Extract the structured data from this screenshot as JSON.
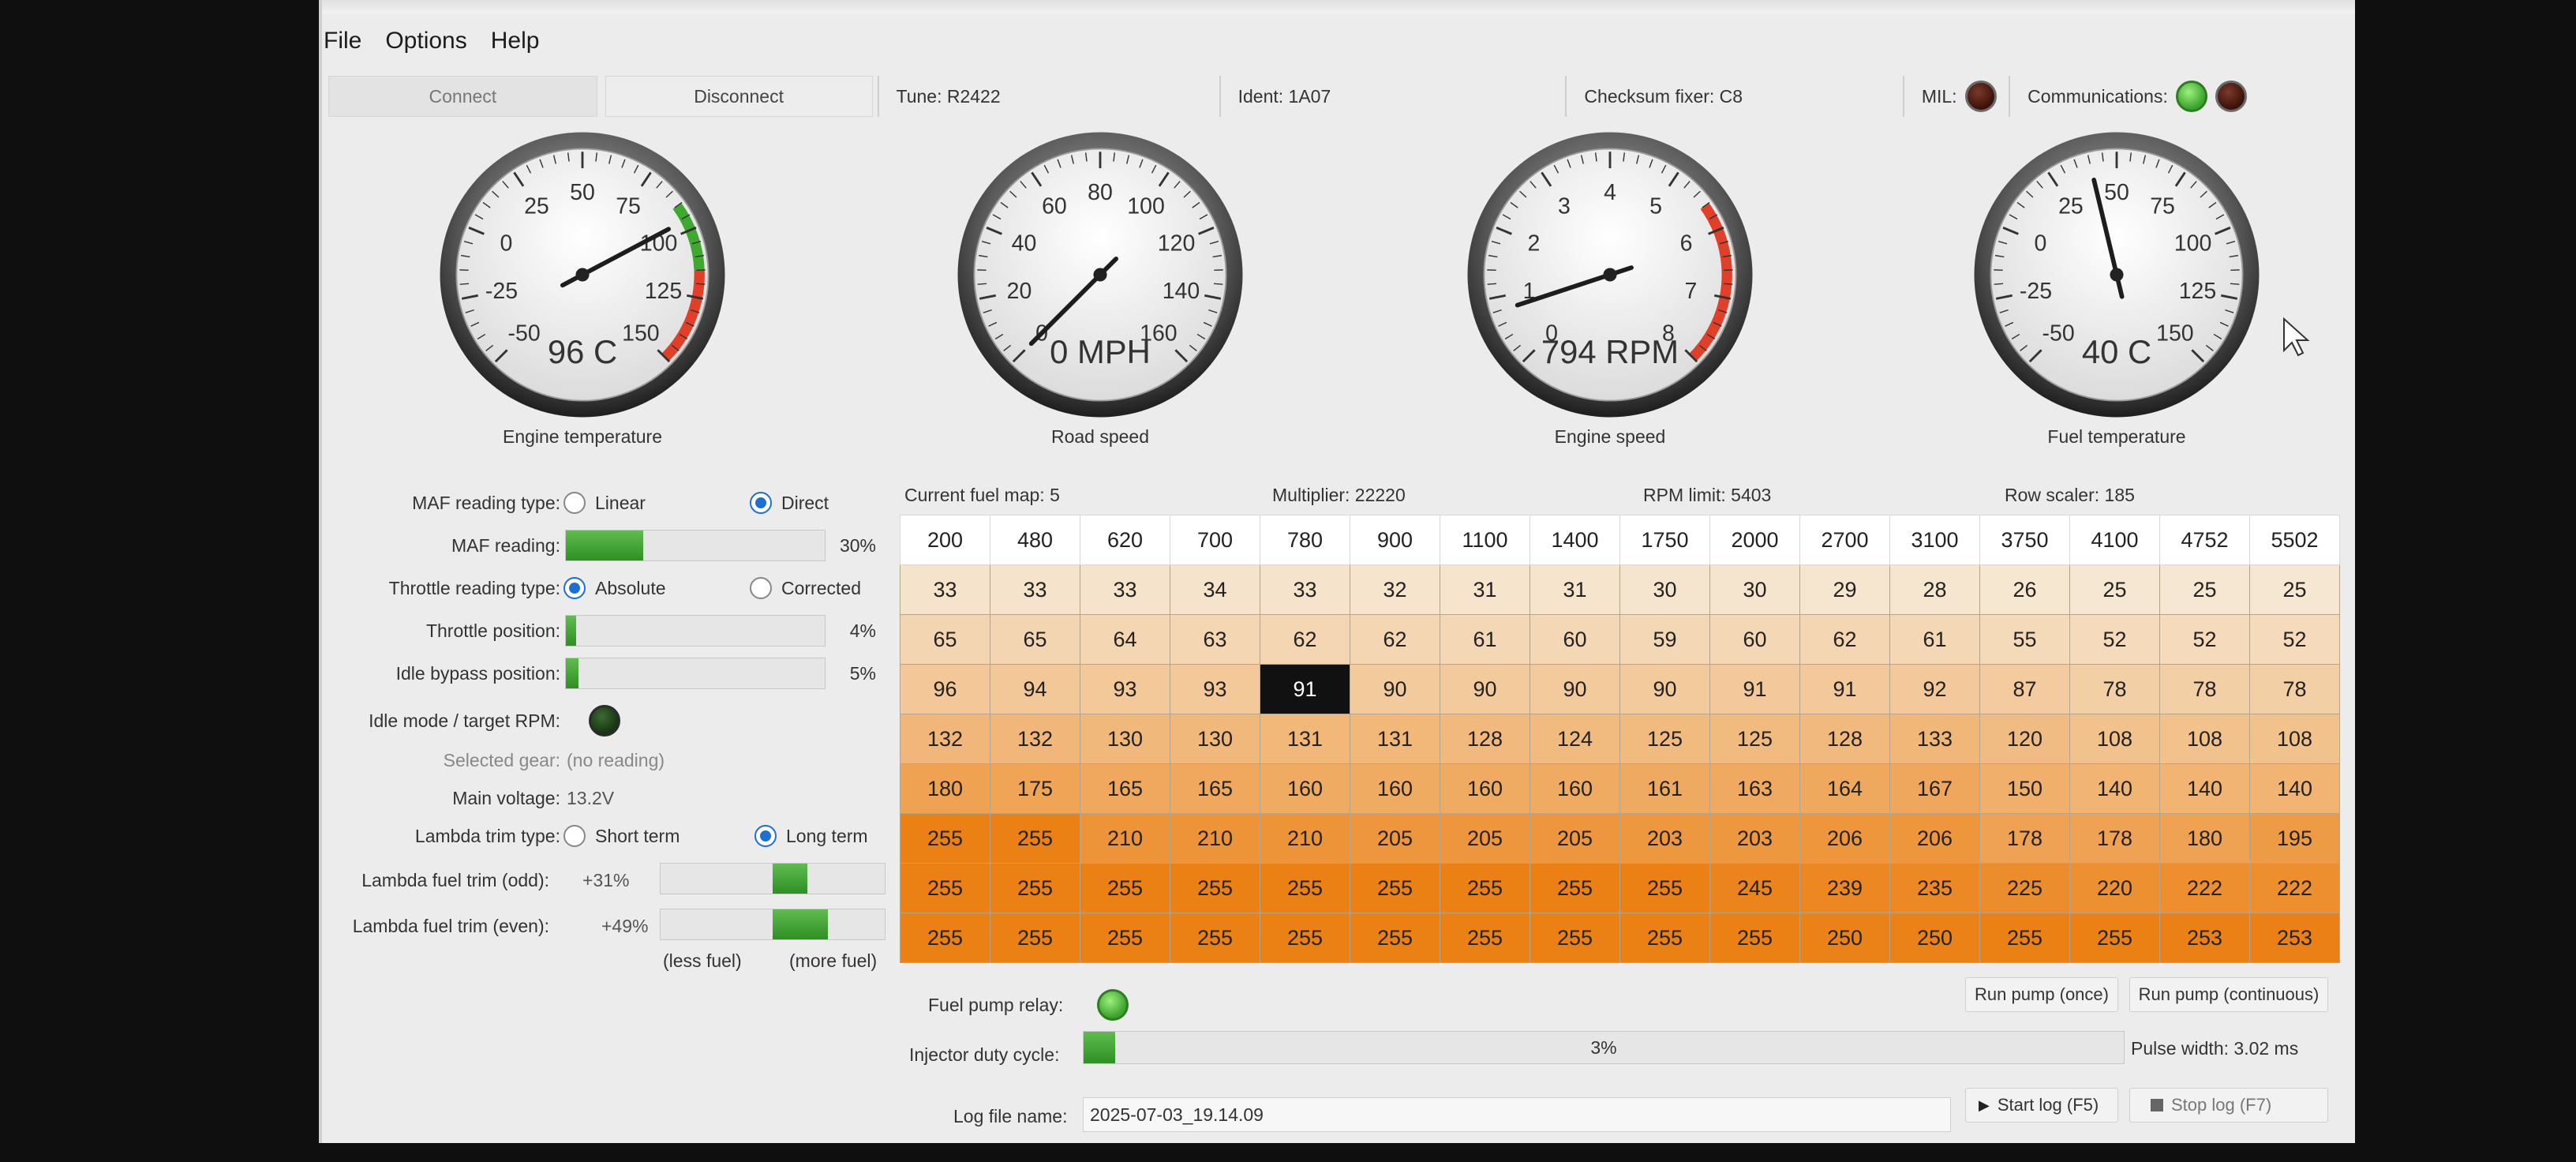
{
  "menu": [
    "File",
    "Options",
    "Help"
  ],
  "top": {
    "connect": "Connect",
    "disconnect": "Disconnect",
    "tune": "Tune: R2422",
    "ident": "Ident: 1A07",
    "checksum": "Checksum fixer: C8",
    "mil_label": "MIL:",
    "comms_label": "Communications:"
  },
  "gauges": {
    "engine_temp": {
      "caption": "Engine temperature",
      "readout": "96 C",
      "ticks": [
        "-50",
        "-25",
        "0",
        "25",
        "50",
        "75",
        "100",
        "125",
        "150"
      ],
      "value": 96,
      "min": -50,
      "max": 150
    },
    "road_speed": {
      "caption": "Road speed",
      "readout": "0 MPH",
      "ticks": [
        "0",
        "20",
        "40",
        "60",
        "80",
        "100",
        "120",
        "140",
        "160"
      ],
      "value": 0,
      "min": 0,
      "max": 160
    },
    "engine_speed": {
      "caption": "Engine speed",
      "readout": "794 RPM",
      "ticks": [
        "0",
        "1",
        "2",
        "3",
        "4",
        "5",
        "6",
        "7",
        "8"
      ],
      "value": 0.794,
      "min": 0,
      "max": 8
    },
    "fuel_temp": {
      "caption": "Fuel temperature",
      "readout": "40 C",
      "ticks": [
        "-50",
        "-25",
        "0",
        "25",
        "50",
        "75",
        "100",
        "125",
        "150"
      ],
      "value": 40,
      "min": -50,
      "max": 150
    }
  },
  "left": {
    "maf_type_label": "MAF reading type:",
    "maf_type_opt1": "Linear",
    "maf_type_opt2": "Direct",
    "maf_reading_label": "MAF reading:",
    "maf_reading_val": "30%",
    "maf_reading_frac": 0.3,
    "throttle_type_label": "Throttle reading type:",
    "throttle_type_opt1": "Absolute",
    "throttle_type_opt2": "Corrected",
    "throttle_pos_label": "Throttle position:",
    "throttle_pos_val": "4%",
    "throttle_pos_frac": 0.04,
    "idle_bypass_label": "Idle bypass position:",
    "idle_bypass_val": "5%",
    "idle_bypass_frac": 0.05,
    "idle_mode_label": "Idle mode / target RPM:",
    "gear_label": "Selected gear:",
    "gear_val": "(no reading)",
    "voltage_label": "Main voltage:",
    "voltage_val": "13.2V",
    "lambda_type_label": "Lambda trim type:",
    "lambda_type_opt1": "Short term",
    "lambda_type_opt2": "Long term",
    "lambda_odd_label": "Lambda fuel trim (odd):",
    "lambda_odd_val": "+31%",
    "lambda_odd_frac": 0.31,
    "lambda_even_label": "Lambda fuel trim (even):",
    "lambda_even_val": "+49%",
    "lambda_even_frac": 0.49,
    "less_fuel": "(less fuel)",
    "more_fuel": "(more fuel)"
  },
  "map": {
    "current": "Current fuel map: 5",
    "multiplier": "Multiplier: 22220",
    "rpm_limit": "RPM limit: 5403",
    "row_scaler": "Row scaler: 185",
    "columns": [
      "200",
      "480",
      "620",
      "700",
      "780",
      "900",
      "1100",
      "1400",
      "1750",
      "2000",
      "2700",
      "3100",
      "3750",
      "4100",
      "4752",
      "5502"
    ],
    "rows": [
      [
        "33",
        "33",
        "33",
        "34",
        "33",
        "32",
        "31",
        "31",
        "30",
        "30",
        "29",
        "28",
        "26",
        "25",
        "25",
        "25"
      ],
      [
        "65",
        "65",
        "64",
        "63",
        "62",
        "62",
        "61",
        "60",
        "59",
        "60",
        "62",
        "61",
        "55",
        "52",
        "52",
        "52"
      ],
      [
        "96",
        "94",
        "93",
        "93",
        "91",
        "90",
        "90",
        "90",
        "90",
        "91",
        "91",
        "92",
        "87",
        "78",
        "78",
        "78"
      ],
      [
        "132",
        "132",
        "130",
        "130",
        "131",
        "131",
        "128",
        "124",
        "125",
        "125",
        "128",
        "133",
        "120",
        "108",
        "108",
        "108"
      ],
      [
        "180",
        "175",
        "165",
        "165",
        "160",
        "160",
        "160",
        "160",
        "161",
        "163",
        "164",
        "167",
        "150",
        "140",
        "140",
        "140"
      ],
      [
        "255",
        "255",
        "210",
        "210",
        "210",
        "205",
        "205",
        "205",
        "203",
        "203",
        "206",
        "206",
        "178",
        "178",
        "180",
        "195"
      ],
      [
        "255",
        "255",
        "255",
        "255",
        "255",
        "255",
        "255",
        "255",
        "255",
        "245",
        "239",
        "235",
        "225",
        "220",
        "222",
        "222"
      ],
      [
        "255",
        "255",
        "255",
        "255",
        "255",
        "255",
        "255",
        "255",
        "255",
        "255",
        "250",
        "250",
        "255",
        "255",
        "253",
        "253"
      ]
    ],
    "selected_row": 2,
    "selected_col": 4
  },
  "bottom": {
    "pump_relay_label": "Fuel pump relay:",
    "run_once": "Run pump (once)",
    "run_cont": "Run pump (continuous)",
    "injector_label": "Injector duty cycle:",
    "injector_val": "3%",
    "injector_frac": 0.03,
    "pulse_width": "Pulse width: 3.02 ms",
    "log_label": "Log file name:",
    "log_value": "2025-07-03_19.14.09",
    "start_log": "Start log (F5)",
    "stop_log": "Stop log (F7)"
  }
}
